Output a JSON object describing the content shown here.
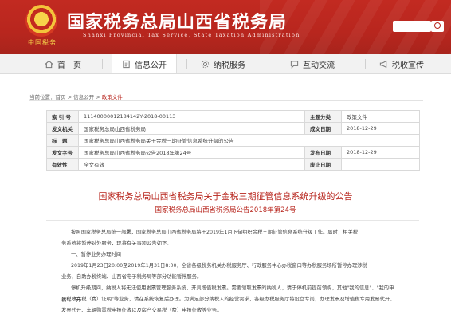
{
  "site": {
    "title": "国家税务总局山西省税务局",
    "subtitle": "Shanxi Provincial Tax Service, State Taxation Administration",
    "emblem_text": "中国税务"
  },
  "nav": {
    "items": [
      {
        "label": "首　页",
        "icon": "home-icon",
        "active": false
      },
      {
        "label": "信息公开",
        "icon": "info-doc-icon",
        "active": true
      },
      {
        "label": "纳税服务",
        "icon": "gear-service-icon",
        "active": false
      },
      {
        "label": "互动交流",
        "icon": "chat-icon",
        "active": false
      },
      {
        "label": "税收宣传",
        "icon": "megaphone-icon",
        "active": false
      }
    ]
  },
  "breadcrumb": {
    "parts": [
      "当前位置：",
      "首页",
      " > ",
      "信息公开",
      " > ",
      "政策文件"
    ]
  },
  "meta": {
    "index_label": "索 引 号",
    "index_value": "11140000012184142Y-2018-00113",
    "category_label": "主题分类",
    "category_value": "政策文件",
    "org_label": "发文机关",
    "org_value": "国家税务总局山西省税务局",
    "date_label": "成文日期",
    "date_value": "2018-12-29",
    "subject_label": "标　题",
    "subject_value": "国家税务总局山西省税务局关于金税三期征管信息系统升级的公告",
    "number_label": "发文字号",
    "number_value": "国家税务总局山西省税务局公告2018年第24号",
    "pub_label": "发布日期",
    "pub_value": "2018-12-29",
    "valid_label": "有效性",
    "valid_value": "全文有效",
    "expire_label": "废止日期",
    "expire_value": ""
  },
  "doc": {
    "title": "国家税务总局山西省税务局关于金税三期征管信息系统升级的公告",
    "number": "国家税务总局山西省税务局公告2018年第24号",
    "paragraphs": [
      "按照国家税务总局统一部署，国家税务总局山西省税务局将于2019年1月下旬组织金税三期征管信息系统升级工作。届时，相关税",
      "务系统将暂停对外服务，现将有关事项公告如下：",
      "一、暂停业务办理时间",
      "2019年1月23日20:00至2019年1月31日8:00，全省各级税务机关办税服务厅、行政服务中心办税窗口等办税服务场所暂停办理涉税",
      "业务，自助办税终端、山西省电子税务局等部分功能暂停服务。",
      "停机升级期间，纳税人将无法使用发票管理服务系统、开具增值税发票。需要领取发票的纳税人，请于停机前提前领购，其他\"我的信息\"、\"我的申请\"、\"开",
      "具税收完税（费）证明\"等业务，请在系统恢复后办理。为满足部分纳税人的经营需求，各级办税服务厅将设立专岗，办理发票及增值税专用发票代开、",
      "发票代开、车辆购置税申报征收以及房产交易税（费）申报征收等业务。"
    ]
  },
  "colors": {
    "brand_red": "#b8261e",
    "nav_bg": "#f2f2f2"
  }
}
